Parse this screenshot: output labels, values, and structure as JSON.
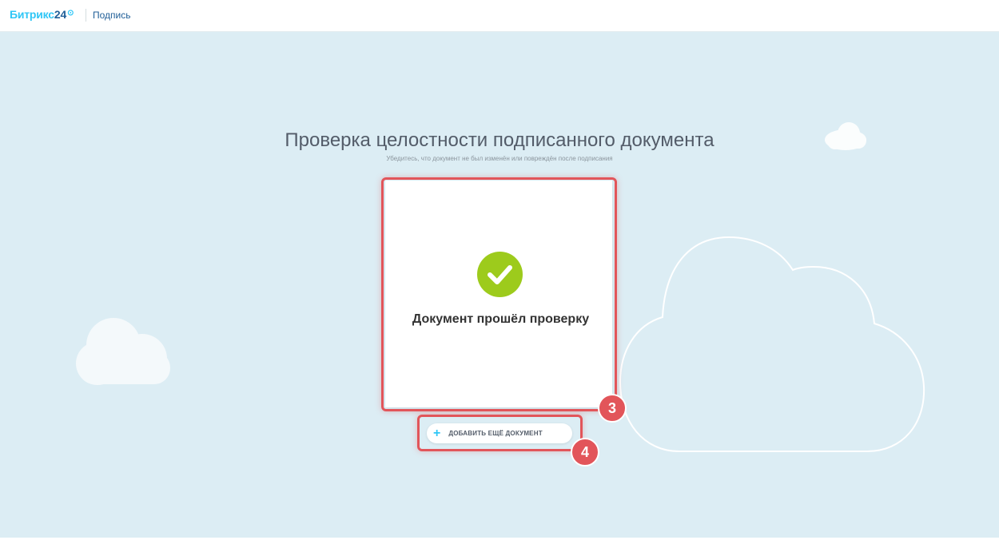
{
  "header": {
    "logo_brand": "Битрикс",
    "logo_number": "24",
    "logo_clock": "⊙",
    "section": "Подпись"
  },
  "main": {
    "title": "Проверка целостности подписанного документа",
    "subtitle": "Убедитесь, что документ не был изменён или повреждён после подписания",
    "result_text": "Документ прошёл проверку",
    "add_button_label": "ДОБАВИТЬ ЕЩЁ ДОКУМЕНТ"
  },
  "annotations": {
    "card_badge": "3",
    "button_badge": "4"
  },
  "colors": {
    "background": "#dcedf4",
    "accent": "#2fc6f6",
    "success": "#9dcb1c",
    "highlight": "#e2555a"
  },
  "icons": {
    "check": "check-icon",
    "plus": "plus-icon"
  }
}
